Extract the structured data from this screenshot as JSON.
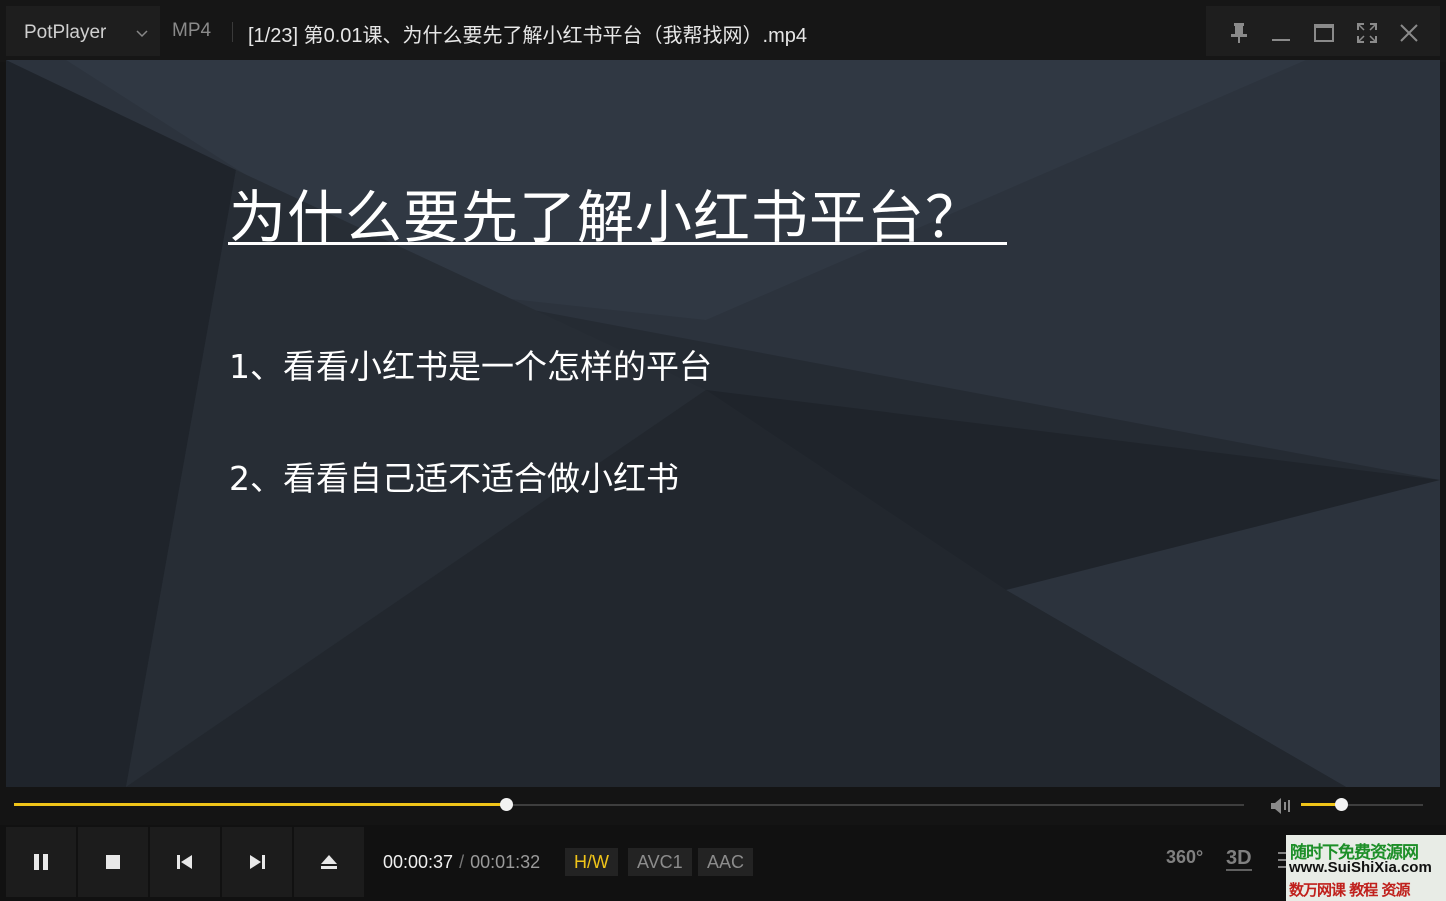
{
  "app": {
    "name": "PotPlayer",
    "format": "MP4",
    "filename": "[1/23] 第0.01课、为什么要先了解小红书平台（我帮找网）.mp4"
  },
  "window_controls": {
    "icons": [
      "pin-icon",
      "minimize-icon",
      "maximize-icon",
      "fullscreen-icon",
      "close-icon"
    ]
  },
  "slide": {
    "title": "为什么要先了解小红书平台？",
    "bullets": [
      "1、看看小红书是一个怎样的平台",
      "2、看看自己适不适合做小红书"
    ],
    "background_color": "#232830"
  },
  "playback": {
    "current_time": "00:00:37",
    "separator": "/",
    "duration": "00:01:32",
    "progress": 0.4,
    "volume": 0.33,
    "accent_color": "#f0c419"
  },
  "controls": {
    "icons": [
      "pause-icon",
      "stop-icon",
      "previous-icon",
      "next-icon",
      "eject-icon"
    ]
  },
  "badges": {
    "hw": "H/W",
    "video_codec": "AVC1",
    "audio_codec": "AAC"
  },
  "right_buttons": {
    "vr": "360°",
    "three_d": "3D"
  },
  "watermark": {
    "line1": "随时下免费资源网",
    "line2": "www.SuiShiXia.com",
    "line3": "数万网课 教程 资源"
  }
}
